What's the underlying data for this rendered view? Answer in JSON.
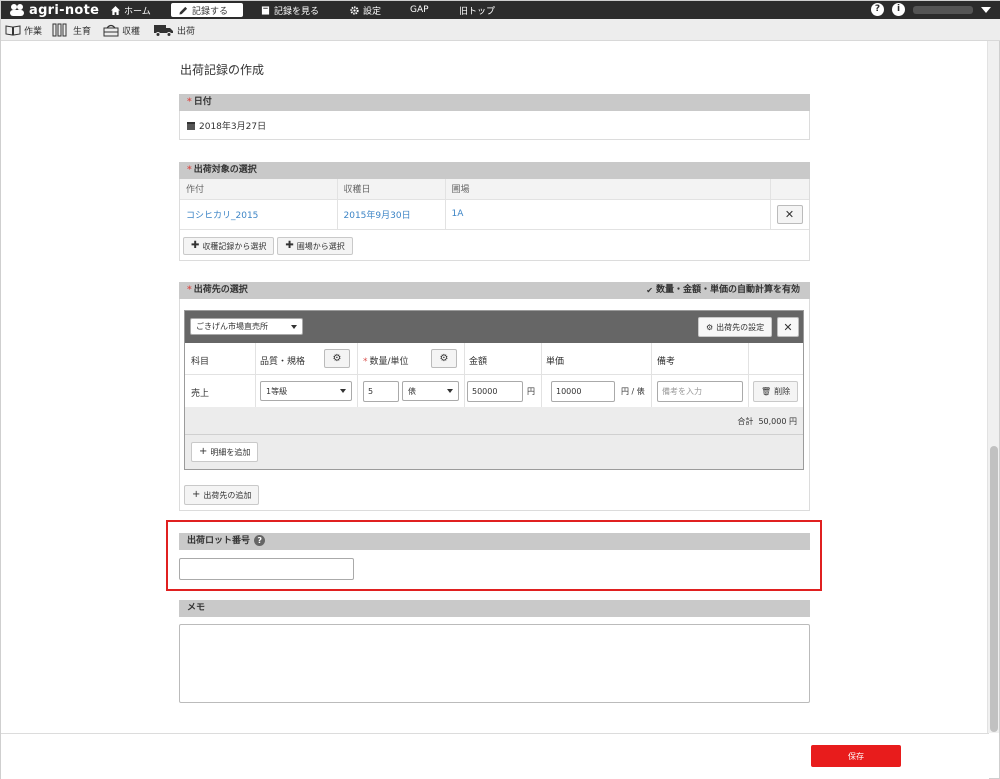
{
  "app": {
    "logo_text": "agri-note"
  },
  "nav": {
    "home": "ホーム",
    "record": "記録する",
    "view": "記録を見る",
    "settings": "設定",
    "gap": "GAP",
    "old_top": "旧トップ"
  },
  "subnav": {
    "work": "作業",
    "growth": "生育",
    "harvest": "収穫",
    "shipping": "出荷"
  },
  "page": {
    "title": "出荷記録の作成"
  },
  "date_section": {
    "header": "日付",
    "value": "2018年3月27日"
  },
  "target_section": {
    "header": "出荷対象の選択",
    "columns": [
      "作付",
      "収穫日",
      "圃場"
    ],
    "rows": [
      {
        "crop": "コシヒカリ_2015",
        "harvest_date": "2015年9月30日",
        "field": "1A"
      }
    ],
    "btn_from_harvest": "収穫記録から選択",
    "btn_from_field": "圃場から選択"
  },
  "dest_section": {
    "header": "出荷先の選択",
    "auto_calc": "数量・金額・単価の自動計算を有効",
    "dest_selected": "ごきげん市場直売所",
    "dest_settings_btn": "出荷先の設定",
    "columns": {
      "subject": "科目",
      "quality": "品質・規格",
      "qty_unit": "数量/単位",
      "amount": "金額",
      "unit_price": "単価",
      "note": "備考"
    },
    "row": {
      "subject": "売上",
      "quality": "1等級",
      "qty": "5",
      "unit": "俵",
      "amount": "50000",
      "amount_unit": "円",
      "unit_price": "10000",
      "unit_price_unit": "円 / 俵",
      "note_placeholder": "備考を入力",
      "delete": "削除"
    },
    "total_label": "合計",
    "total_value": "50,000 円",
    "add_detail": "明細を追加",
    "add_dest": "出荷先の追加"
  },
  "lot_section": {
    "header": "出荷ロット番号",
    "value": ""
  },
  "memo_section": {
    "header": "メモ",
    "value": ""
  },
  "footer": {
    "save": "保存"
  },
  "colors": {
    "nav_bg": "#2c2c2c",
    "section_header": "#c9c9c9",
    "link": "#3d85c6",
    "save": "#e81c1c",
    "highlight": "#e02020"
  }
}
